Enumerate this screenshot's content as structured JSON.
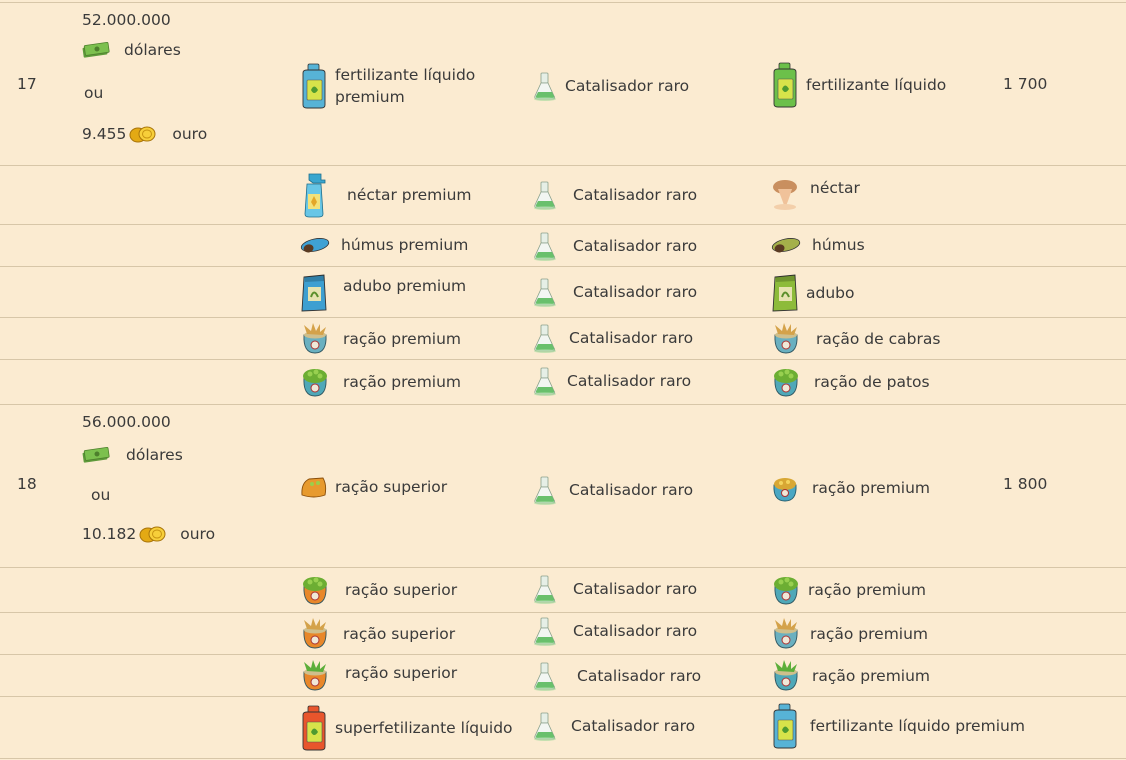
{
  "groups": [
    {
      "level": "17",
      "price": {
        "dollars": "52.000.000",
        "dollars_label": "dólares",
        "or": "ou",
        "gold": "9.455",
        "gold_label": "ouro"
      },
      "points": "1 700",
      "recipes": [
        {
          "a": "fertilizante líquido premium",
          "b": "Catalisador raro",
          "c": "fertilizante líquido",
          "icons": [
            "blue-jug-icon",
            "catalyst-flask-icon",
            "green-jug-icon"
          ]
        },
        {
          "a": "néctar premium",
          "b": "Catalisador raro",
          "c": "néctar",
          "icons": [
            "spray-bottle-icon",
            "catalyst-flask-icon",
            "nectar-drop-icon"
          ]
        },
        {
          "a": "húmus premium",
          "b": "Catalisador raro",
          "c": "húmus",
          "icons": [
            "humus-premium-icon",
            "catalyst-flask-icon",
            "humus-icon"
          ]
        },
        {
          "a": "adubo premium",
          "b": "Catalisador raro",
          "c": "adubo",
          "icons": [
            "blue-fertilizer-bag-icon",
            "catalyst-flask-icon",
            "green-fertilizer-bag-icon"
          ]
        },
        {
          "a": "ração premium",
          "b": "Catalisador raro",
          "c": "ração de cabras",
          "icons": [
            "hay-feed-sack-icon",
            "catalyst-flask-icon",
            "hay-feed-sack-icon"
          ]
        },
        {
          "a": "ração premium",
          "b": "Catalisador raro",
          "c": "ração de patos",
          "icons": [
            "pea-feed-sack-icon",
            "catalyst-flask-icon",
            "pea-feed-sack-icon"
          ]
        }
      ]
    },
    {
      "level": "18",
      "price": {
        "dollars": "56.000.000",
        "dollars_label": "dólares",
        "or": "ou",
        "gold": "10.182",
        "gold_label": "ouro"
      },
      "points": "1 800",
      "recipes": [
        {
          "a": "ração superior",
          "b": "Catalisador raro",
          "c": "ração premium",
          "icons": [
            "orange-feed-bag-icon",
            "catalyst-flask-icon",
            "blue-feed-bag-icon"
          ]
        },
        {
          "a": "ração superior",
          "b": "Catalisador raro",
          "c": "ração premium",
          "icons": [
            "orange-feed-sack-icon",
            "catalyst-flask-icon",
            "pea-feed-sack-icon"
          ]
        },
        {
          "a": "ração superior",
          "b": "Catalisador raro",
          "c": "ração premium",
          "icons": [
            "hay-feed-orange-icon",
            "catalyst-flask-icon",
            "hay-feed-sack-icon"
          ]
        },
        {
          "a": "ração superior",
          "b": "Catalisador raro",
          "c": "ração premium",
          "icons": [
            "veggie-feed-orange-icon",
            "catalyst-flask-icon",
            "veggie-feed-blue-icon"
          ]
        },
        {
          "a": "superfetilizante líquido",
          "b": "Catalisador raro",
          "c": "fertilizante líquido premium",
          "icons": [
            "orange-jug-icon",
            "catalyst-flask-icon",
            "blue-jug-icon"
          ]
        }
      ]
    }
  ]
}
